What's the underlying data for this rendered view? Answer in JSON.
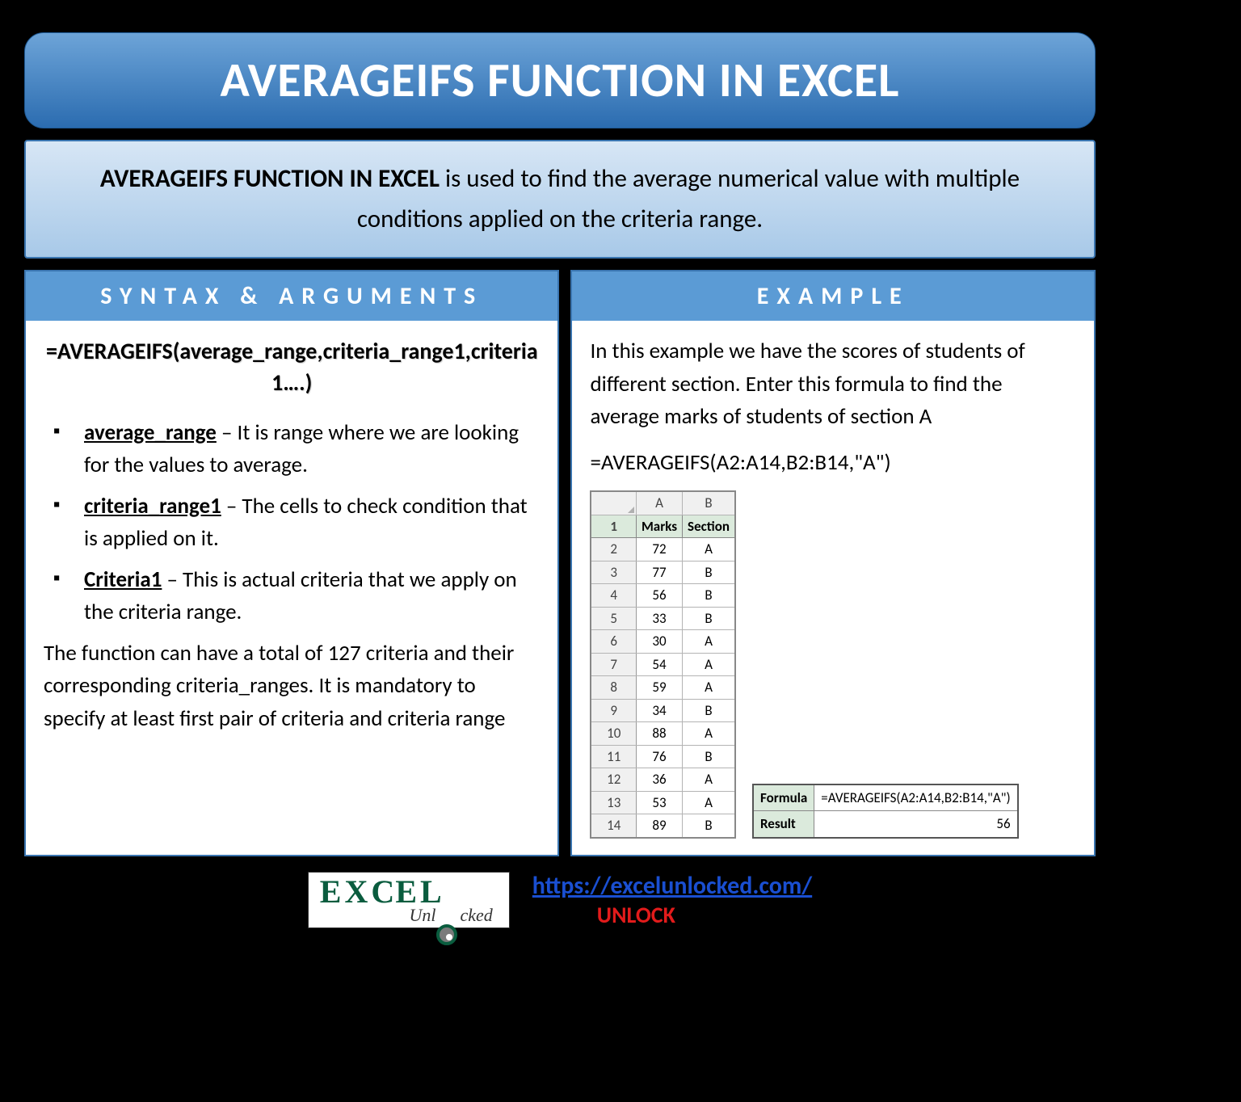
{
  "title": "AVERAGEIFS FUNCTION IN EXCEL",
  "description": {
    "bold_lead": "AVERAGEIFS FUNCTION IN EXCEL",
    "rest": " is used to find the average numerical value with multiple conditions applied on the criteria range."
  },
  "syntax_panel": {
    "header": "SYNTAX & ARGUMENTS",
    "formula": "=AVERAGEIFS(average_range,criteria_range1,criteria1….)",
    "args": [
      {
        "name": "average_range",
        "desc": " – It is range where we are looking for the values to average."
      },
      {
        "name": "criteria_range1",
        "desc": " – The cells to check condition that is applied on it."
      },
      {
        "name": "Criteria1",
        "desc": " – This is actual criteria that we apply on the criteria range."
      }
    ],
    "note": "The function can have a total of 127 criteria and their corresponding criteria_ranges. It is mandatory to specify at least first pair of criteria and criteria range"
  },
  "example_panel": {
    "header": "EXAMPLE",
    "intro": "In this example we have the scores of students of different section. Enter this formula to find the average marks of students of section A",
    "formula": "=AVERAGEIFS(A2:A14,B2:B14,\"A\")",
    "sheet": {
      "cols": [
        "A",
        "B"
      ],
      "header_row": [
        "Marks",
        "Section"
      ],
      "rows": [
        [
          "72",
          "A"
        ],
        [
          "77",
          "B"
        ],
        [
          "56",
          "B"
        ],
        [
          "33",
          "B"
        ],
        [
          "30",
          "A"
        ],
        [
          "54",
          "A"
        ],
        [
          "59",
          "A"
        ],
        [
          "34",
          "B"
        ],
        [
          "88",
          "A"
        ],
        [
          "76",
          "B"
        ],
        [
          "36",
          "A"
        ],
        [
          "53",
          "A"
        ],
        [
          "89",
          "B"
        ]
      ]
    },
    "result_box": {
      "formula_label": "Formula",
      "formula_value": "=AVERAGEIFS(A2:A14,B2:B14,\"A\")",
      "result_label": "Result",
      "result_value": "56"
    }
  },
  "footer": {
    "logo_top": "EX  EL",
    "logo_sub": "Unl  cked",
    "url": "https://excelunlocked.com/",
    "unlock": "UNLOCK"
  },
  "chart_data": {
    "type": "table",
    "title": "Marks by Section",
    "columns": [
      "Marks",
      "Section"
    ],
    "rows": [
      [
        72,
        "A"
      ],
      [
        77,
        "B"
      ],
      [
        56,
        "B"
      ],
      [
        33,
        "B"
      ],
      [
        30,
        "A"
      ],
      [
        54,
        "A"
      ],
      [
        59,
        "A"
      ],
      [
        34,
        "B"
      ],
      [
        88,
        "A"
      ],
      [
        76,
        "B"
      ],
      [
        36,
        "A"
      ],
      [
        53,
        "A"
      ],
      [
        89,
        "B"
      ]
    ],
    "computed": {
      "formula": "=AVERAGEIFS(A2:A14,B2:B14,\"A\")",
      "result": 56
    }
  }
}
